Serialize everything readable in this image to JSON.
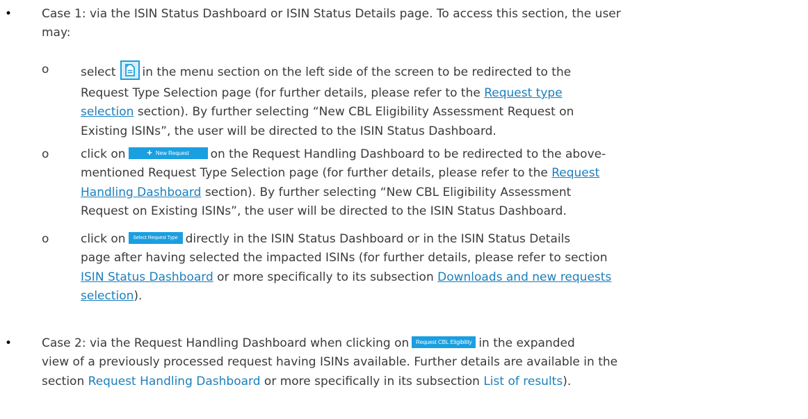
{
  "case1": {
    "line1": "Case 1: via the ISIN Status Dashboard or ISIN Status Details page. To access this section, the user",
    "line2": "may:",
    "sub1": {
      "select_word": "select",
      "l1_after_icon": "in the menu section on the left side of the screen to be redirected to the",
      "l2_before_link": "Request Type Selection page (for further details, please refer to the",
      "link_part1": "Request type",
      "link_part2": "selection",
      "l3_after_link": "section). By further selecting “New CBL Eligibility Assessment Request on",
      "l4": "Existing ISINs”, the user will be directed to the ISIN Status Dashboard."
    },
    "sub2": {
      "click_on": "click on",
      "button_label": "New Request",
      "l1_after_button": "on the Request Handling Dashboard to be redirected to the above-",
      "l2_before_link": "mentioned Request Type Selection page (for further details, please refer to the",
      "link_part1": "Request",
      "link_part2": "Handling Dashboard",
      "l3_after_link": "section). By further selecting “New CBL Eligibility Assessment",
      "l4": "Request on Existing ISINs”, the user will be directed to the ISIN Status Dashboard."
    },
    "sub3": {
      "click_on": "click on",
      "button_label": "Select Request Type",
      "l1_after_button": "directly in the ISIN Status Dashboard or in the ISIN Status Details",
      "l2": "page after having selected the impacted ISINs (for further details, please refer to section",
      "link1": "ISIN Status Dashboard",
      "mid": "or more specifically to its subsection",
      "link2_part1": "Downloads and new requests",
      "link2_part2": "selection",
      "end": ")."
    }
  },
  "case2": {
    "l1_before_button": "Case 2: via the Request Handling Dashboard when clicking on",
    "button_label": "Request CBL Eligibility",
    "l1_after_button": "in the expanded",
    "l2": "view of a previously processed request having ISINs available. Further details are available in the",
    "l3_before_link": "section",
    "link1": "Request Handling Dashboard",
    "mid": "or more specifically in its subsection",
    "link2": "List of results",
    "end": ")."
  },
  "bullets": {
    "level1": "•",
    "level2": "o"
  },
  "icons": {
    "request-menu-icon": "document-icon"
  },
  "colors": {
    "text": "#3a3a3a",
    "link": "#1a7fbd",
    "button": "#1a9fe0"
  }
}
